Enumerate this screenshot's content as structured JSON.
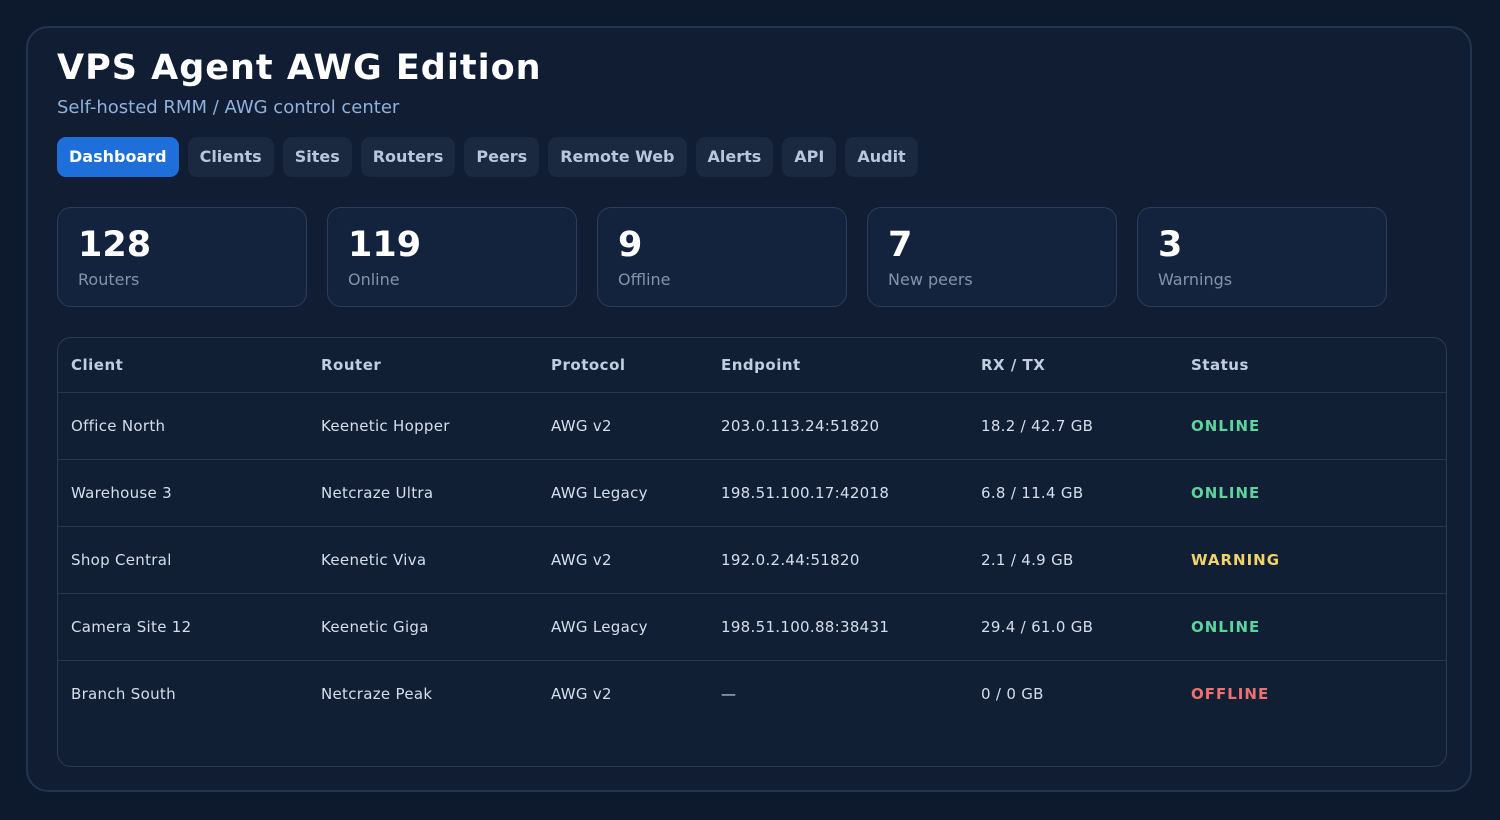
{
  "app": {
    "title": "VPS Agent AWG Edition",
    "subtitle": "Self-hosted RMM / AWG control center"
  },
  "tabs": [
    {
      "label": "Dashboard",
      "active": true
    },
    {
      "label": "Clients",
      "active": false
    },
    {
      "label": "Sites",
      "active": false
    },
    {
      "label": "Routers",
      "active": false
    },
    {
      "label": "Peers",
      "active": false
    },
    {
      "label": "Remote Web",
      "active": false
    },
    {
      "label": "Alerts",
      "active": false
    },
    {
      "label": "API",
      "active": false
    },
    {
      "label": "Audit",
      "active": false
    }
  ],
  "stats": [
    {
      "value": "128",
      "label": "Routers"
    },
    {
      "value": "119",
      "label": "Online"
    },
    {
      "value": "9",
      "label": "Offline"
    },
    {
      "value": "7",
      "label": "New peers"
    },
    {
      "value": "3",
      "label": "Warnings"
    }
  ],
  "table": {
    "columns": [
      "Client",
      "Router",
      "Protocol",
      "Endpoint",
      "RX / TX",
      "Status"
    ],
    "rows": [
      {
        "client": "Office North",
        "router": "Keenetic Hopper",
        "protocol": "AWG v2",
        "endpoint": "203.0.113.24:51820",
        "rxtx": "18.2 / 42.7 GB",
        "status": "ONLINE"
      },
      {
        "client": "Warehouse 3",
        "router": "Netcraze Ultra",
        "protocol": "AWG Legacy",
        "endpoint": "198.51.100.17:42018",
        "rxtx": "6.8 / 11.4 GB",
        "status": "ONLINE"
      },
      {
        "client": "Shop Central",
        "router": "Keenetic Viva",
        "protocol": "AWG v2",
        "endpoint": "192.0.2.44:51820",
        "rxtx": "2.1 / 4.9 GB",
        "status": "WARNING"
      },
      {
        "client": "Camera Site 12",
        "router": "Keenetic Giga",
        "protocol": "AWG Legacy",
        "endpoint": "198.51.100.88:38431",
        "rxtx": "29.4 / 61.0 GB",
        "status": "ONLINE"
      },
      {
        "client": "Branch South",
        "router": "Netcraze Peak",
        "protocol": "AWG v2",
        "endpoint": "—",
        "rxtx": "0 / 0 GB",
        "status": "OFFLINE"
      }
    ]
  },
  "status_colors": {
    "ONLINE": "#5dd39e",
    "WARNING": "#f2d36b",
    "OFFLINE": "#f07070"
  },
  "colors": {
    "accent": "#1e6fd9",
    "background": "#0d1a2e",
    "panel": "#101d33"
  }
}
